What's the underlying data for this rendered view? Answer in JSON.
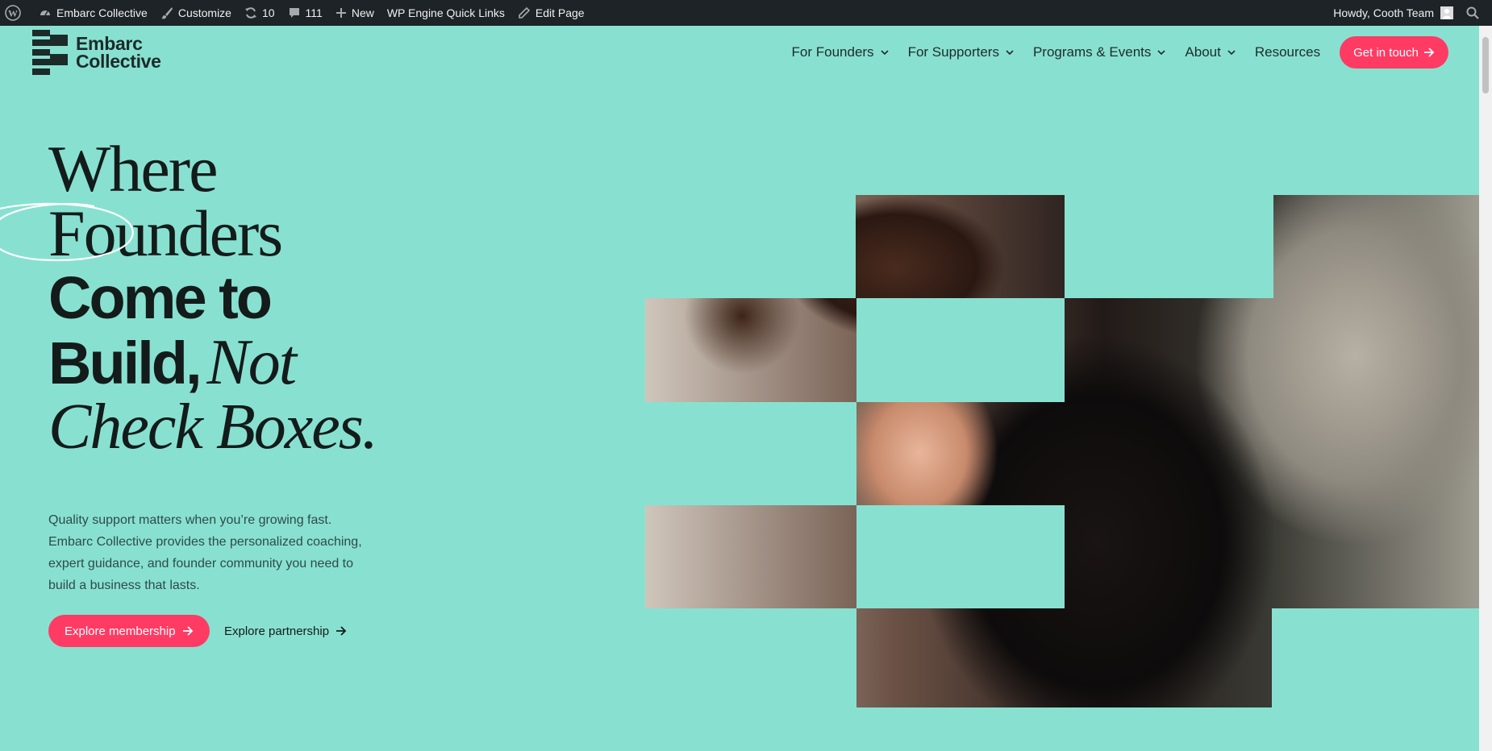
{
  "adminbar": {
    "site_name": "Embarc Collective",
    "customize": "Customize",
    "updates_count": "10",
    "comments_count": "111",
    "new_label": "New",
    "quick_links": "WP Engine Quick Links",
    "edit_page": "Edit Page",
    "howdy": "Howdy, Cooth Team"
  },
  "brand": {
    "line1": "Embarc",
    "line2": "Collective"
  },
  "nav": {
    "items": [
      "For Founders",
      "For Supporters",
      "Programs & Events",
      "About",
      "Resources"
    ],
    "cta": "Get in touch"
  },
  "hero": {
    "line1": "Where",
    "line2": "Founders",
    "line3": "Come to",
    "line4_bold": "Build,",
    "line4_italic": "Not",
    "line5": "Check Boxes.",
    "subtitle": "Quality support matters when you’re growing fast. Embarc Collective provides the personalized coaching, expert guidance, and founder community you need to build a business that lasts.",
    "primary_button": "Explore membership",
    "secondary_button": "Explore partnership"
  },
  "colors": {
    "background": "#88e1d0",
    "accent": "#ff3b63",
    "adminbar": "#1d2327",
    "text": "#141b1b"
  }
}
